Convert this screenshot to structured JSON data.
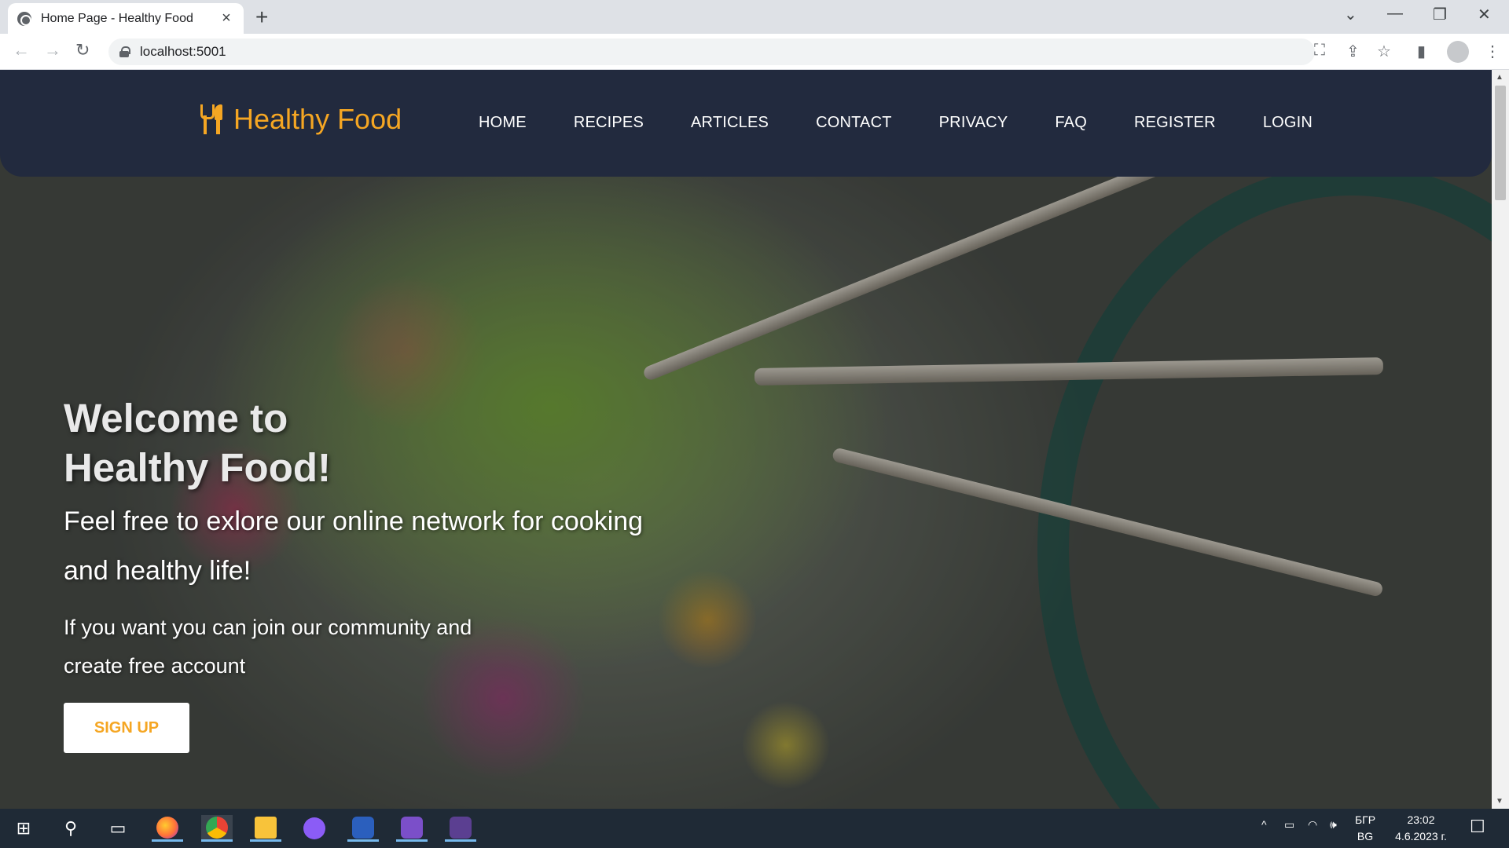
{
  "browser": {
    "tab_title": "Home Page - Healthy Food",
    "tab_close": "×",
    "new_tab": "+",
    "url": "localhost:5001",
    "controls": {
      "minimize": "—",
      "restore": "❐",
      "close": "✕",
      "tab_search": "⌄"
    },
    "nav": {
      "back": "←",
      "forward": "→",
      "reload": "↻"
    },
    "toolbar_icons": {
      "translate": "⛶",
      "share": "⇪",
      "bookmark": "☆",
      "side_panel": "▮",
      "menu": "⋮"
    }
  },
  "site": {
    "brand": "Healthy Food",
    "nav": [
      "HOME",
      "RECIPES",
      "ARTICLES",
      "CONTACT",
      "PRIVACY",
      "FAQ",
      "REGISTER",
      "LOGIN"
    ],
    "hero": {
      "title_line1": "Welcome to",
      "title_line2": "Healthy Food!",
      "subtitle": "Feel free to exlore our online network for cooking and healthy life!",
      "text": "If you want you can join our community and create free account",
      "cta": "SIGN UP"
    },
    "colors": {
      "accent": "#f5a623",
      "navbar": "#222a3e"
    }
  },
  "taskbar": {
    "lang_line1": "БГР",
    "lang_line2": "BG",
    "time": "23:02",
    "date": "4.6.2023 г.",
    "apps": [
      "start-icon",
      "search-icon",
      "task-view-icon",
      "firefox-icon",
      "chrome-icon",
      "file-explorer-icon",
      "github-desktop-icon",
      "word-icon",
      "visual-studio-icon",
      "terminal-icon"
    ]
  }
}
